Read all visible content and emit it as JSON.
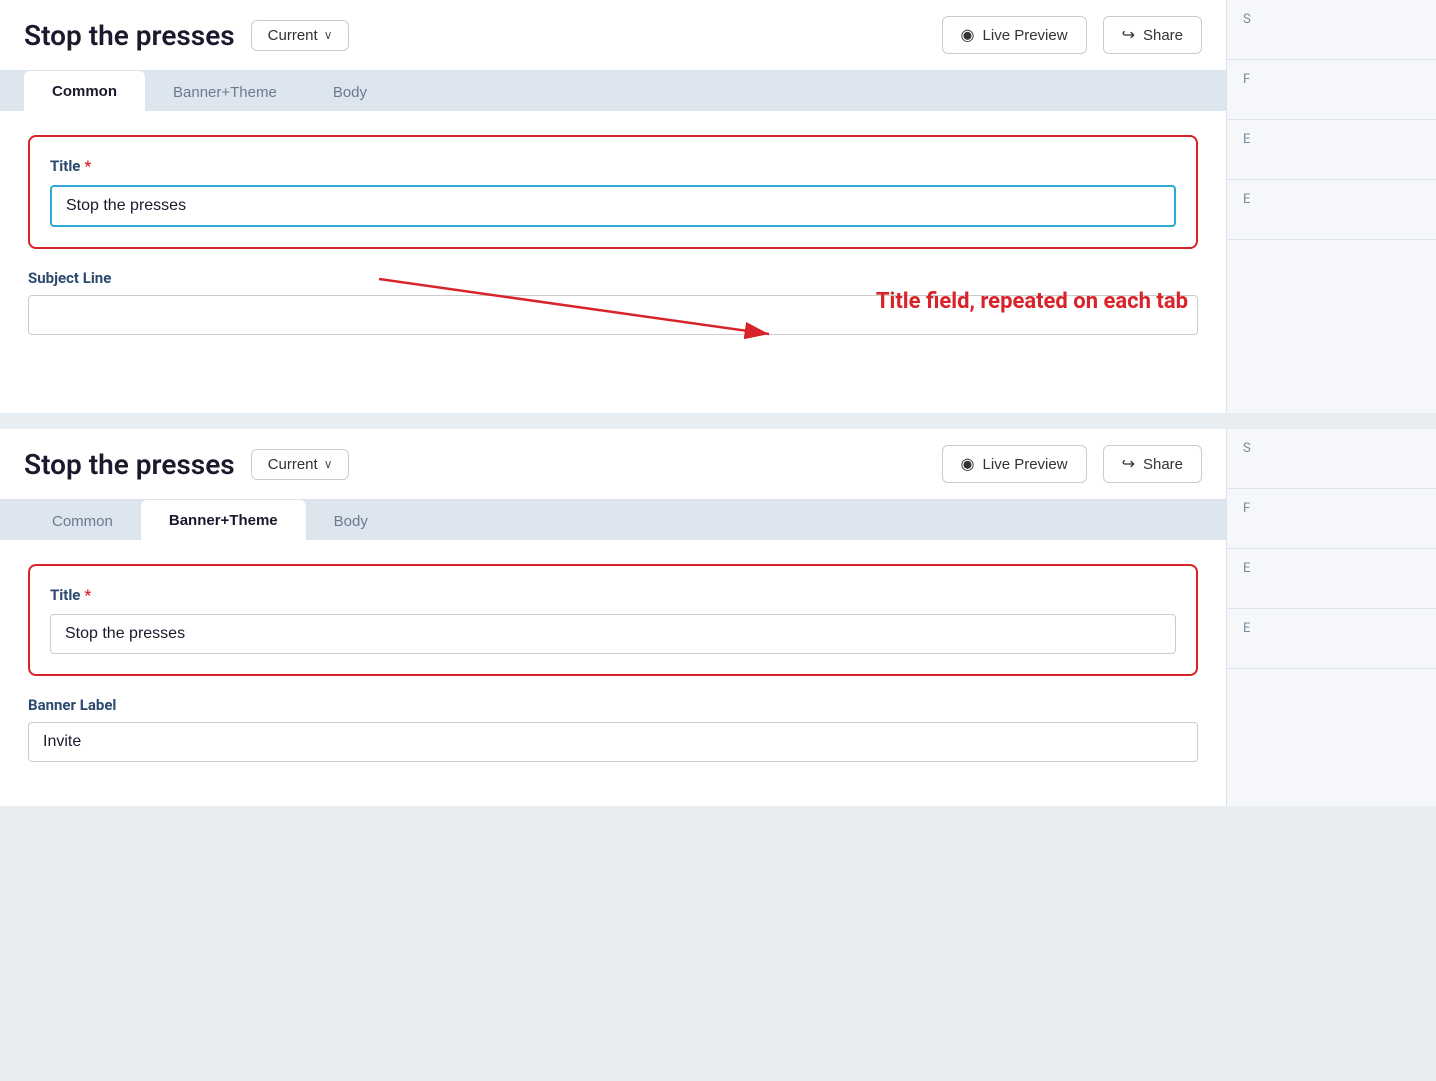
{
  "app": {
    "title": "Stop the presses"
  },
  "panel1": {
    "title": "Stop the presses",
    "version_label": "Current",
    "live_preview_label": "Live Preview",
    "share_label": "Share",
    "tabs": [
      {
        "id": "common",
        "label": "Common",
        "active": true
      },
      {
        "id": "banner-theme",
        "label": "Banner+Theme",
        "active": false
      },
      {
        "id": "body",
        "label": "Body",
        "active": false
      }
    ],
    "title_field_label": "Title",
    "title_field_value": "Stop the presses",
    "subject_line_label": "Subject Line",
    "subject_line_value": "",
    "subject_line_placeholder": ""
  },
  "annotation": {
    "text": "Title field, repeated on each tab"
  },
  "panel2": {
    "title": "Stop the presses",
    "version_label": "Current",
    "live_preview_label": "Live Preview",
    "share_label": "Share",
    "tabs": [
      {
        "id": "common",
        "label": "Common",
        "active": false
      },
      {
        "id": "banner-theme",
        "label": "Banner+Theme",
        "active": true
      },
      {
        "id": "body",
        "label": "Body",
        "active": false
      }
    ],
    "title_field_label": "Title",
    "title_field_value": "Stop the presses",
    "banner_label_label": "Banner Label",
    "banner_label_value": "Invite"
  },
  "icons": {
    "eye": "◉",
    "share": "↪",
    "chevron_down": "∨"
  }
}
